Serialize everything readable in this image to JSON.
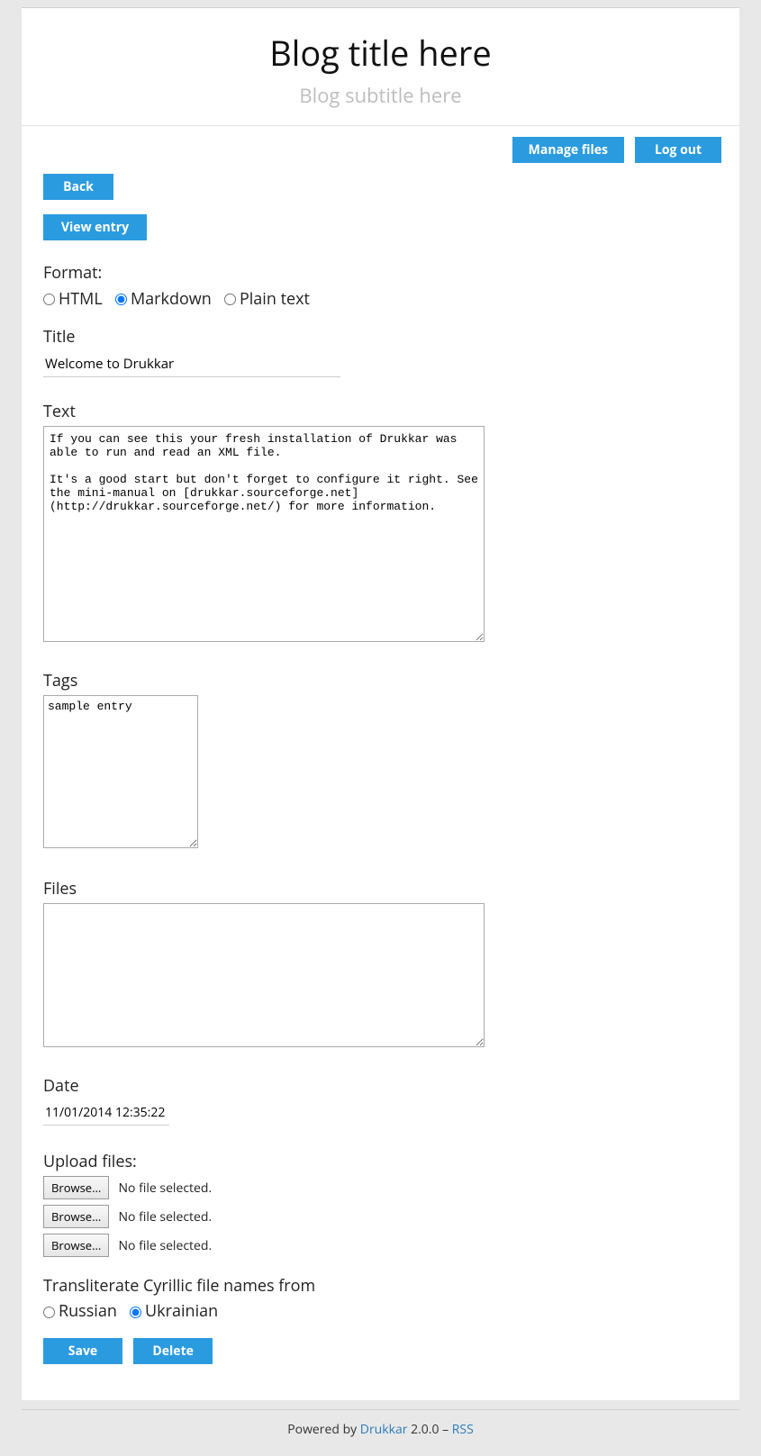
{
  "header": {
    "title": "Blog title here",
    "subtitle": "Blog subtitle here"
  },
  "topbar": {
    "manage_files": "Manage files",
    "log_out": "Log out"
  },
  "nav": {
    "back": "Back",
    "view_entry": "View entry"
  },
  "format": {
    "label": "Format:",
    "options": {
      "html": "HTML",
      "markdown": "Markdown",
      "plain": "Plain text"
    },
    "selected": "markdown"
  },
  "title_field": {
    "label": "Title",
    "value": "Welcome to Drukkar"
  },
  "text_field": {
    "label": "Text",
    "value": "If you can see this your fresh installation of Drukkar was able to run and read an XML file.\n\nIt's a good start but don't forget to configure it right. See the mini-manual on [drukkar.sourceforge.net](http://drukkar.sourceforge.net/) for more information."
  },
  "tags_field": {
    "label": "Tags",
    "value": "sample entry"
  },
  "files_field": {
    "label": "Files",
    "value": ""
  },
  "date_field": {
    "label": "Date",
    "value": "11/01/2014 12:35:22"
  },
  "upload": {
    "label": "Upload files:",
    "browse": "Browse...",
    "no_file": "No file selected."
  },
  "translit": {
    "label": "Transliterate Cyrillic file names from",
    "options": {
      "russian": "Russian",
      "ukrainian": "Ukrainian"
    },
    "selected": "ukrainian"
  },
  "actions": {
    "save": "Save",
    "delete": "Delete"
  },
  "footer": {
    "powered_by": "Powered by ",
    "app": "Drukkar",
    "version": " 2.0.0 – ",
    "rss": "RSS"
  }
}
